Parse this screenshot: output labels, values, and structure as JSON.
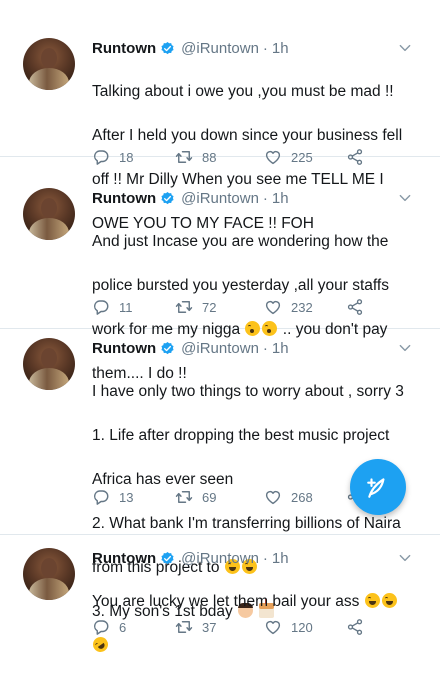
{
  "colors": {
    "verified": "#1da1f2",
    "meta_text": "#657786",
    "body_text": "#14171a",
    "fab": "#1da1f2"
  },
  "tweets": [
    {
      "name": "Runtown",
      "handle": "@iRuntown",
      "separator": "·",
      "time": "1h",
      "lines": [
        "Talking about i owe you ,you must be mad !!",
        "After I held you down since your business fell",
        "off !! Mr Dilly When you see me TELL ME  I",
        "OWE YOU TO MY FACE !! FOH"
      ],
      "replies": "18",
      "retweets": "88",
      "likes": "225"
    },
    {
      "name": "Runtown",
      "handle": "@iRuntown",
      "separator": "·",
      "time": "1h",
      "lines": [
        "And just Incase you are wondering how the",
        "police bursted you yesterday ,all your staffs",
        "work for me my nigga",
        ".. you don't pay",
        "them.... I do !!"
      ],
      "replies": "11",
      "retweets": "72",
      "likes": "232"
    },
    {
      "name": "Runtown",
      "handle": "@iRuntown",
      "separator": "·",
      "time": "1h",
      "lines": [
        "I have only two things to worry about , sorry 3",
        "1. Life after dropping the best music project",
        "Africa has ever seen",
        "2. What bank I'm transferring billions of Naira",
        "from this project to",
        "3. My son's 1st bday"
      ],
      "replies": "13",
      "retweets": "69",
      "likes": "268"
    },
    {
      "name": "Runtown",
      "handle": "@iRuntown",
      "separator": "·",
      "time": "1h",
      "lines": [
        "You are lucky we let them bail your ass"
      ],
      "replies": "6",
      "retweets": "37",
      "likes": "120"
    }
  ],
  "icons": {
    "verified": "verified-badge-icon",
    "menu": "chevron-down-icon",
    "reply": "reply-icon",
    "retweet": "retweet-icon",
    "like": "heart-icon",
    "share": "share-icon",
    "compose": "compose-tweet-icon"
  }
}
